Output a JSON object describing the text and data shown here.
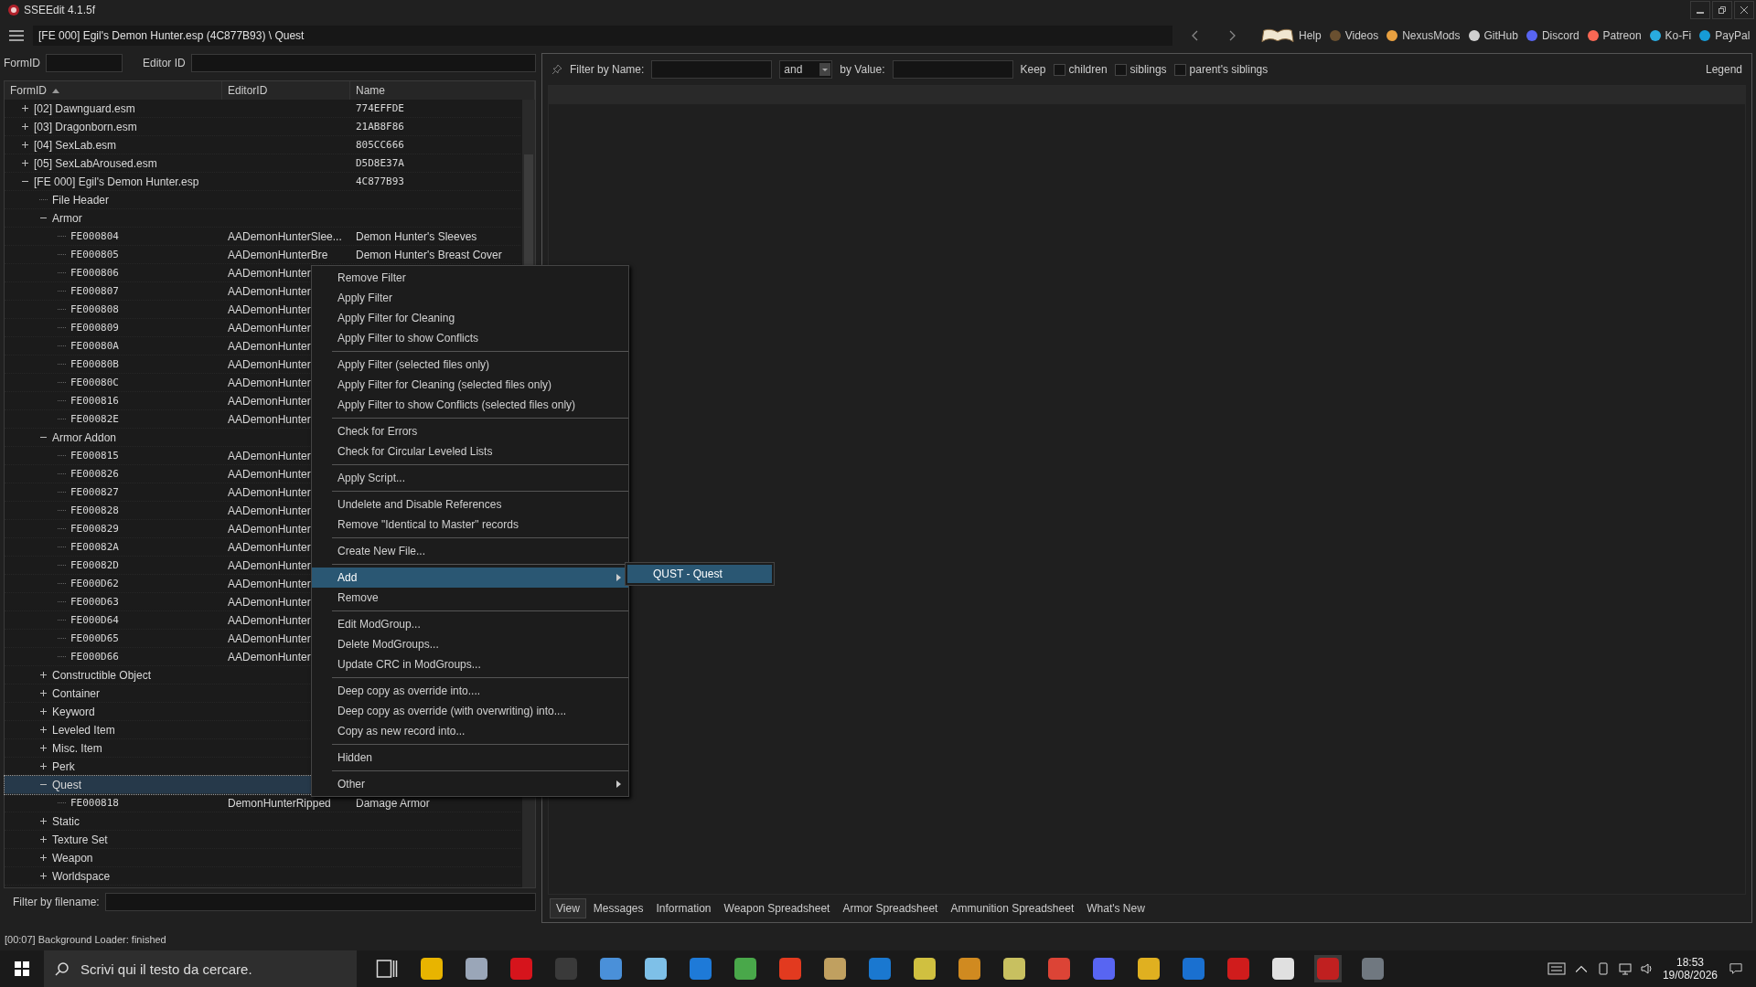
{
  "window": {
    "title": "SSEEdit 4.1.5f"
  },
  "breadcrumb": "[FE 000] Egil's Demon Hunter.esp (4C877B93) \\ Quest",
  "links": [
    "Help",
    "Videos",
    "NexusMods",
    "GitHub",
    "Discord",
    "Patreon",
    "Ko-Fi",
    "PayPal"
  ],
  "left_filters": [
    {
      "label": "FormID"
    },
    {
      "label": "Editor ID"
    }
  ],
  "tree": {
    "columns": [
      {
        "label": "FormID",
        "sorted": true
      },
      {
        "label": "EditorID",
        "sorted": false
      },
      {
        "label": "Name",
        "sorted": false
      }
    ],
    "nodes": [
      {
        "label": "[02] Dawnguard.esm",
        "name": "774EFFDE",
        "expanded": false,
        "selected": false
      },
      {
        "label": "[03] Dragonborn.esm",
        "name": "21AB8F86",
        "expanded": false,
        "selected": false
      },
      {
        "label": "[04] SexLab.esm",
        "name": "805CC666",
        "expanded": false,
        "selected": false
      },
      {
        "label": "[05] SexLabAroused.esm",
        "name": "D5D8E37A",
        "expanded": false,
        "selected": false
      },
      {
        "label": "[FE 000] Egil's Demon Hunter.esp",
        "name": "4C877B93",
        "expanded": true,
        "selected": false,
        "children": [
          {
            "label": "File Header",
            "selected": false
          },
          {
            "label": "Armor",
            "expanded": true,
            "selected": false,
            "children": [
              {
                "form_id": "FE000804",
                "editor_id": "AADemonHunterSlee...",
                "name": "Demon Hunter's Sleeves",
                "selected": false
              },
              {
                "form_id": "FE000805",
                "editor_id": "AADemonHunterBre",
                "name": "Demon Hunter's Breast Cover",
                "selected": false
              },
              {
                "form_id": "FE000806",
                "editor_id": "AADemonHunter",
                "selected": false
              },
              {
                "form_id": "FE000807",
                "editor_id": "AADemonHunter",
                "selected": false
              },
              {
                "form_id": "FE000808",
                "editor_id": "AADemonHunter",
                "selected": false
              },
              {
                "form_id": "FE000809",
                "editor_id": "AADemonHunter",
                "selected": false
              },
              {
                "form_id": "FE00080A",
                "editor_id": "AADemonHunter",
                "selected": false
              },
              {
                "form_id": "FE00080B",
                "editor_id": "AADemonHunter",
                "selected": false
              },
              {
                "form_id": "FE00080C",
                "editor_id": "AADemonHunter",
                "selected": false
              },
              {
                "form_id": "FE000816",
                "editor_id": "AADemonHunter",
                "selected": false
              },
              {
                "form_id": "FE00082E",
                "editor_id": "AADemonHunter",
                "selected": false
              }
            ]
          },
          {
            "label": "Armor Addon",
            "expanded": true,
            "selected": false,
            "children": [
              {
                "form_id": "FE000815",
                "editor_id": "AADemonHunter",
                "selected": false
              },
              {
                "form_id": "FE000826",
                "editor_id": "AADemonHunter",
                "selected": false
              },
              {
                "form_id": "FE000827",
                "editor_id": "AADemonHunter",
                "selected": false
              },
              {
                "form_id": "FE000828",
                "editor_id": "AADemonHunter",
                "selected": false
              },
              {
                "form_id": "FE000829",
                "editor_id": "AADemonHunter",
                "selected": false
              },
              {
                "form_id": "FE00082A",
                "editor_id": "AADemonHunter",
                "selected": false
              },
              {
                "form_id": "FE00082D",
                "editor_id": "AADemonHunter",
                "selected": false
              },
              {
                "form_id": "FE000D62",
                "editor_id": "AADemonHunter",
                "selected": false
              },
              {
                "form_id": "FE000D63",
                "editor_id": "AADemonHunter",
                "selected": false
              },
              {
                "form_id": "FE000D64",
                "editor_id": "AADemonHunter",
                "selected": false
              },
              {
                "form_id": "FE000D65",
                "editor_id": "AADemonHunter",
                "selected": false
              },
              {
                "form_id": "FE000D66",
                "editor_id": "AADemonHunter",
                "selected": false
              }
            ]
          },
          {
            "label": "Constructible Object",
            "expanded": false,
            "selected": false
          },
          {
            "label": "Container",
            "expanded": false,
            "selected": false
          },
          {
            "label": "Keyword",
            "expanded": false,
            "selected": false
          },
          {
            "label": "Leveled Item",
            "expanded": false,
            "selected": false
          },
          {
            "label": "Misc. Item",
            "expanded": false,
            "selected": false
          },
          {
            "label": "Perk",
            "expanded": false,
            "selected": false
          },
          {
            "label": "Quest",
            "expanded": true,
            "selected": true,
            "children": [
              {
                "form_id": "FE000818",
                "editor_id": "DemonHunterRipped",
                "name": "Damage Armor",
                "selected": false
              }
            ]
          },
          {
            "label": "Static",
            "expanded": false,
            "selected": false
          },
          {
            "label": "Texture Set",
            "expanded": false,
            "selected": false
          },
          {
            "label": "Weapon",
            "expanded": false,
            "selected": false
          },
          {
            "label": "Worldspace",
            "expanded": false,
            "selected": false
          }
        ]
      }
    ]
  },
  "filename_filter": {
    "label": "Filter by filename:"
  },
  "status_bar": "[00:07] Background Loader: finished",
  "filter_bar": {
    "name_label": "Filter by Name:",
    "operator": "and",
    "value_label": "by Value:",
    "keep_label": "Keep",
    "options": [
      {
        "label": "children",
        "checked": false
      },
      {
        "label": "siblings",
        "checked": false
      },
      {
        "label": "parent's siblings",
        "checked": false
      }
    ],
    "legend": "Legend"
  },
  "view_tabs": [
    {
      "label": "View",
      "selected": true
    },
    {
      "label": "Messages",
      "selected": false
    },
    {
      "label": "Information",
      "selected": false
    },
    {
      "label": "Weapon Spreadsheet",
      "selected": false
    },
    {
      "label": "Armor Spreadsheet",
      "selected": false
    },
    {
      "label": "Ammunition Spreadsheet",
      "selected": false
    },
    {
      "label": "What's New",
      "selected": false
    }
  ],
  "context_menu": [
    {
      "kind": "item",
      "label": "Remove Filter",
      "selected": false,
      "submenu": false
    },
    {
      "kind": "item",
      "label": "Apply Filter",
      "selected": false,
      "submenu": false
    },
    {
      "kind": "item",
      "label": "Apply Filter for Cleaning",
      "selected": false,
      "submenu": false
    },
    {
      "kind": "item",
      "label": "Apply Filter to show Conflicts",
      "selected": false,
      "submenu": false
    },
    {
      "kind": "separator"
    },
    {
      "kind": "item",
      "label": "Apply Filter (selected files only)",
      "selected": false,
      "submenu": false
    },
    {
      "kind": "item",
      "label": "Apply Filter for Cleaning (selected files only)",
      "selected": false,
      "submenu": false
    },
    {
      "kind": "item",
      "label": "Apply Filter to show Conflicts (selected files only)",
      "selected": false,
      "submenu": false
    },
    {
      "kind": "separator"
    },
    {
      "kind": "item",
      "label": "Check for Errors",
      "selected": false,
      "submenu": false
    },
    {
      "kind": "item",
      "label": "Check for Circular Leveled Lists",
      "selected": false,
      "submenu": false
    },
    {
      "kind": "separator"
    },
    {
      "kind": "item",
      "label": "Apply Script...",
      "selected": false,
      "submenu": false
    },
    {
      "kind": "separator"
    },
    {
      "kind": "item",
      "label": "Undelete and Disable References",
      "selected": false,
      "submenu": false
    },
    {
      "kind": "item",
      "label": "Remove \"Identical to Master\" records",
      "selected": false,
      "submenu": false
    },
    {
      "kind": "separator"
    },
    {
      "kind": "item",
      "label": "Create New File...",
      "selected": false,
      "submenu": false
    },
    {
      "kind": "separator"
    },
    {
      "kind": "item",
      "label": "Add",
      "selected": true,
      "submenu": true
    },
    {
      "kind": "item",
      "label": "Remove",
      "selected": false,
      "submenu": false
    },
    {
      "kind": "separator"
    },
    {
      "kind": "item",
      "label": "Edit ModGroup...",
      "selected": false,
      "submenu": false
    },
    {
      "kind": "item",
      "label": "Delete ModGroups...",
      "selected": false,
      "submenu": false
    },
    {
      "kind": "item",
      "label": "Update CRC in ModGroups...",
      "selected": false,
      "submenu": false
    },
    {
      "kind": "separator"
    },
    {
      "kind": "item",
      "label": "Deep copy as override into....",
      "selected": false,
      "submenu": false
    },
    {
      "kind": "item",
      "label": "Deep copy as override (with overwriting) into....",
      "selected": false,
      "submenu": false
    },
    {
      "kind": "item",
      "label": "Copy as new record into...",
      "selected": false,
      "submenu": false
    },
    {
      "kind": "separator"
    },
    {
      "kind": "item",
      "label": "Hidden",
      "selected": false,
      "submenu": false
    },
    {
      "kind": "separator"
    },
    {
      "kind": "item",
      "label": "Other",
      "selected": false,
      "submenu": true
    }
  ],
  "submenu": [
    {
      "label": "QUST - Quest",
      "selected": true
    }
  ],
  "taskbar": {
    "search_placeholder": "Scrivi qui il testo da cercare.",
    "time": "18:53",
    "date": "19/08/2026"
  }
}
